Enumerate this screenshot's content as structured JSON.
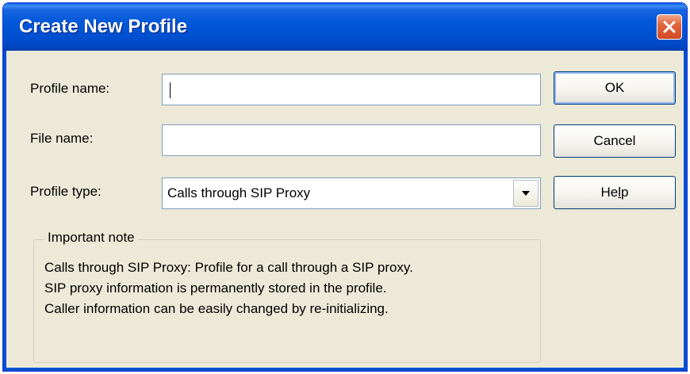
{
  "window": {
    "title": "Create New Profile",
    "close_icon": "close-icon"
  },
  "form": {
    "profile_name_label": "Profile name:",
    "profile_name_value": "",
    "file_name_label": "File name:",
    "file_name_value": "",
    "profile_type_label": "Profile type:",
    "profile_type_value": "Calls through SIP Proxy",
    "dropdown_icon": "chevron-down-icon"
  },
  "buttons": {
    "ok": "OK",
    "cancel": "Cancel",
    "help_prefix": "He",
    "help_underlined": "l",
    "help_suffix": "p"
  },
  "note": {
    "title": "Important note",
    "lines": [
      "Calls through SIP Proxy: Profile for a call through a SIP proxy.",
      "SIP proxy information is permanently stored in the profile.",
      "Caller information can be easily changed by re-initializing."
    ]
  },
  "colors": {
    "titlebar": "#0054e3",
    "dialog_background": "#ece9d8",
    "close_button": "#e2663f"
  }
}
